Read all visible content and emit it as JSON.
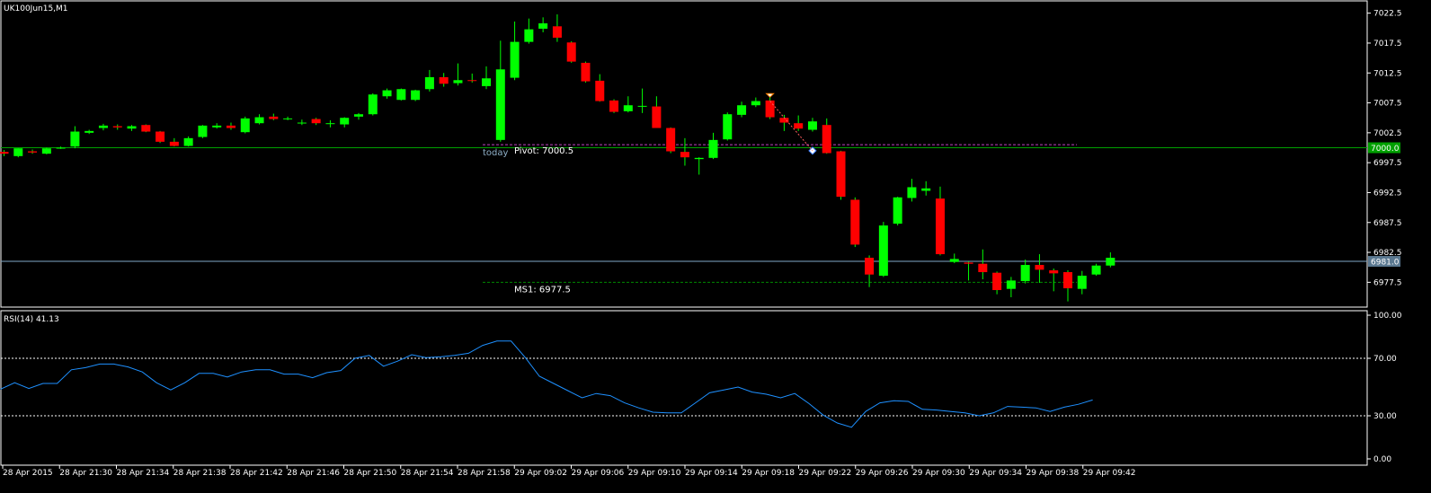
{
  "window": {
    "symbol_label": "UK100Jun15,M1",
    "rsi_label": "RSI(14) 41.13"
  },
  "colors": {
    "background": "#000000",
    "frame": "#ffffff",
    "bull": "#00ff00",
    "bear": "#ff0000",
    "wick": "#00ff00",
    "rsi_line": "#1e90ff",
    "pivot_line": "#00a000",
    "pivot_dash": "#c040c0",
    "bid_line": "#7fa8c8",
    "ms1_dash": "#008800",
    "price_tag_green": "#00a000",
    "price_tag_blue": "#5a7890"
  },
  "chart_data": [
    {
      "type": "candlestick",
      "title": "UK100Jun15,M1",
      "ylim": [
        6973.5,
        7024.4
      ],
      "y_ticks": [
        "7022.5",
        "7017.5",
        "7012.5",
        "7007.5",
        "7002.5",
        "6997.5",
        "6992.5",
        "6987.5",
        "6982.5",
        "6977.5"
      ],
      "y_tick_values": [
        7022.5,
        7017.5,
        7012.5,
        7007.5,
        7002.5,
        6997.5,
        6992.5,
        6987.5,
        6982.5,
        6977.5
      ],
      "price_tags": [
        {
          "text": "7000.0",
          "value": 7000.0,
          "kind": "green"
        },
        {
          "text": "6981.0",
          "value": 6981.0,
          "kind": "blue"
        }
      ],
      "annotations": [
        {
          "text": "today",
          "kind": "today"
        },
        {
          "text": "Pivot: 7000.5",
          "value": 7000.5,
          "kind": "pivot"
        },
        {
          "text": "MS1: 6977.5",
          "value": 6977.5,
          "kind": "ms1"
        }
      ],
      "candles": [
        {
          "o": 6999.3,
          "h": 6999.6,
          "l": 6998.6,
          "c": 6999.0
        },
        {
          "o": 6998.6,
          "h": 6999.9,
          "l": 6998.4,
          "c": 6999.9
        },
        {
          "o": 6999.4,
          "h": 6999.7,
          "l": 6999.0,
          "c": 6999.2
        },
        {
          "o": 6999.0,
          "h": 7000.0,
          "l": 6998.9,
          "c": 6999.9
        },
        {
          "o": 6999.9,
          "h": 7000.2,
          "l": 6999.8,
          "c": 7000.0
        },
        {
          "o": 7000.2,
          "h": 7003.6,
          "l": 6999.9,
          "c": 7002.7
        },
        {
          "o": 7002.5,
          "h": 7003.0,
          "l": 7002.3,
          "c": 7002.8
        },
        {
          "o": 7003.3,
          "h": 7004.0,
          "l": 7002.9,
          "c": 7003.7
        },
        {
          "o": 7003.6,
          "h": 7003.9,
          "l": 7003.0,
          "c": 7003.4
        },
        {
          "o": 7003.2,
          "h": 7003.8,
          "l": 7002.8,
          "c": 7003.6
        },
        {
          "o": 7003.8,
          "h": 7003.9,
          "l": 7002.6,
          "c": 7002.7
        },
        {
          "o": 7002.7,
          "h": 7002.8,
          "l": 7000.8,
          "c": 7001.0
        },
        {
          "o": 7001.0,
          "h": 7001.6,
          "l": 7000.2,
          "c": 7000.3
        },
        {
          "o": 7000.3,
          "h": 7001.9,
          "l": 7000.2,
          "c": 7001.6
        },
        {
          "o": 7001.8,
          "h": 7003.8,
          "l": 7001.6,
          "c": 7003.7
        },
        {
          "o": 7003.4,
          "h": 7004.1,
          "l": 7003.2,
          "c": 7003.7
        },
        {
          "o": 7003.7,
          "h": 7004.2,
          "l": 7003.0,
          "c": 7003.3
        },
        {
          "o": 7002.6,
          "h": 7005.2,
          "l": 7002.4,
          "c": 7004.9
        },
        {
          "o": 7004.1,
          "h": 7005.6,
          "l": 7003.9,
          "c": 7005.1
        },
        {
          "o": 7005.2,
          "h": 7005.7,
          "l": 7004.6,
          "c": 7004.8
        },
        {
          "o": 7004.8,
          "h": 7005.2,
          "l": 7004.6,
          "c": 7004.9
        },
        {
          "o": 7004.2,
          "h": 7004.7,
          "l": 7003.8,
          "c": 7004.2
        },
        {
          "o": 7004.8,
          "h": 7005.0,
          "l": 7003.8,
          "c": 7004.1
        },
        {
          "o": 7004.0,
          "h": 7004.6,
          "l": 7003.4,
          "c": 7004.1
        },
        {
          "o": 7003.9,
          "h": 7005.1,
          "l": 7003.4,
          "c": 7005.0
        },
        {
          "o": 7005.2,
          "h": 7005.8,
          "l": 7004.7,
          "c": 7005.6
        },
        {
          "o": 7005.6,
          "h": 7009.1,
          "l": 7005.4,
          "c": 7008.9
        },
        {
          "o": 7008.6,
          "h": 7009.9,
          "l": 7008.2,
          "c": 7009.6
        },
        {
          "o": 7008.0,
          "h": 7009.9,
          "l": 7007.9,
          "c": 7009.8
        },
        {
          "o": 7008.0,
          "h": 7009.7,
          "l": 7007.8,
          "c": 7009.6
        },
        {
          "o": 7009.8,
          "h": 7013.0,
          "l": 7009.4,
          "c": 7011.8
        },
        {
          "o": 7011.8,
          "h": 7012.5,
          "l": 7010.2,
          "c": 7010.7
        },
        {
          "o": 7010.8,
          "h": 7014.1,
          "l": 7010.4,
          "c": 7011.3
        },
        {
          "o": 7011.3,
          "h": 7012.4,
          "l": 7010.9,
          "c": 7011.2
        },
        {
          "o": 7010.3,
          "h": 7013.6,
          "l": 7009.8,
          "c": 7011.6
        },
        {
          "o": 7001.3,
          "h": 7017.9,
          "l": 7001.0,
          "c": 7013.1
        },
        {
          "o": 7011.7,
          "h": 7021.1,
          "l": 7011.3,
          "c": 7017.7
        },
        {
          "o": 7017.7,
          "h": 7021.6,
          "l": 7017.4,
          "c": 7019.8
        },
        {
          "o": 7019.9,
          "h": 7021.8,
          "l": 7019.3,
          "c": 7020.8
        },
        {
          "o": 7020.3,
          "h": 7022.3,
          "l": 7017.7,
          "c": 7018.4
        },
        {
          "o": 7017.6,
          "h": 7017.8,
          "l": 7014.2,
          "c": 7014.4
        },
        {
          "o": 7014.2,
          "h": 7014.4,
          "l": 7010.9,
          "c": 7011.1
        },
        {
          "o": 7011.2,
          "h": 7012.3,
          "l": 7007.7,
          "c": 7007.8
        },
        {
          "o": 7007.9,
          "h": 7008.1,
          "l": 7005.8,
          "c": 7006.0
        },
        {
          "o": 7006.1,
          "h": 7008.6,
          "l": 7005.9,
          "c": 7007.1
        },
        {
          "o": 7006.9,
          "h": 7009.9,
          "l": 7005.8,
          "c": 7007.0
        },
        {
          "o": 7006.9,
          "h": 7008.6,
          "l": 7003.6,
          "c": 7003.3
        },
        {
          "o": 7003.3,
          "h": 7003.4,
          "l": 6999.1,
          "c": 6999.4
        },
        {
          "o": 6999.3,
          "h": 7001.6,
          "l": 6997.0,
          "c": 6998.4
        },
        {
          "o": 6998.1,
          "h": 6998.4,
          "l": 6995.5,
          "c": 6998.3
        },
        {
          "o": 6998.3,
          "h": 7002.5,
          "l": 6998.1,
          "c": 7001.3
        },
        {
          "o": 7001.4,
          "h": 7005.9,
          "l": 7001.2,
          "c": 7005.6
        },
        {
          "o": 7005.5,
          "h": 7007.7,
          "l": 7005.1,
          "c": 7007.1
        },
        {
          "o": 7007.1,
          "h": 7008.4,
          "l": 7006.8,
          "c": 7007.8
        },
        {
          "o": 7007.9,
          "h": 7009.0,
          "l": 7004.8,
          "c": 7005.1
        },
        {
          "o": 7005.0,
          "h": 7005.5,
          "l": 7002.8,
          "c": 7004.2
        },
        {
          "o": 7004.1,
          "h": 7005.4,
          "l": 7002.8,
          "c": 7003.2
        },
        {
          "o": 7003.0,
          "h": 7005.0,
          "l": 7002.7,
          "c": 7004.4
        },
        {
          "o": 7003.8,
          "h": 7004.9,
          "l": 6999.0,
          "c": 6999.1
        },
        {
          "o": 6999.4,
          "h": 6999.5,
          "l": 6991.3,
          "c": 6991.8
        },
        {
          "o": 6991.3,
          "h": 6991.7,
          "l": 6983.4,
          "c": 6983.8
        },
        {
          "o": 6981.6,
          "h": 6982.0,
          "l": 6976.7,
          "c": 6978.8
        },
        {
          "o": 6978.6,
          "h": 6987.6,
          "l": 6978.4,
          "c": 6987.0
        },
        {
          "o": 6987.3,
          "h": 6991.8,
          "l": 6987.0,
          "c": 6991.7
        },
        {
          "o": 6991.6,
          "h": 6994.8,
          "l": 6991.0,
          "c": 6993.4
        },
        {
          "o": 6992.8,
          "h": 6994.4,
          "l": 6992.0,
          "c": 6993.2
        },
        {
          "o": 6991.5,
          "h": 6993.5,
          "l": 6982.0,
          "c": 6982.2
        },
        {
          "o": 6980.9,
          "h": 6982.3,
          "l": 6980.7,
          "c": 6981.4
        },
        {
          "o": 6980.8,
          "h": 6981.0,
          "l": 6977.8,
          "c": 6980.6
        },
        {
          "o": 6980.6,
          "h": 6983.0,
          "l": 6978.0,
          "c": 6979.2
        },
        {
          "o": 6979.1,
          "h": 6979.3,
          "l": 6975.5,
          "c": 6976.2
        },
        {
          "o": 6976.4,
          "h": 6978.4,
          "l": 6975.0,
          "c": 6977.8
        },
        {
          "o": 6977.7,
          "h": 6981.3,
          "l": 6977.3,
          "c": 6980.4
        },
        {
          "o": 6980.4,
          "h": 6982.2,
          "l": 6977.4,
          "c": 6979.6
        },
        {
          "o": 6979.5,
          "h": 6979.8,
          "l": 6976.0,
          "c": 6979.0
        },
        {
          "o": 6979.2,
          "h": 6979.5,
          "l": 6974.3,
          "c": 6976.5
        },
        {
          "o": 6976.4,
          "h": 6979.4,
          "l": 6975.5,
          "c": 6978.6
        },
        {
          "o": 6978.8,
          "h": 6980.6,
          "l": 6978.6,
          "c": 6980.3
        },
        {
          "o": 6980.3,
          "h": 6982.5,
          "l": 6980.0,
          "c": 6981.6
        }
      ]
    },
    {
      "type": "line",
      "title": "RSI(14) 41.13",
      "ylim": [
        0,
        100
      ],
      "y_ticks": [
        "100.00",
        "70.00",
        "30.00",
        "0.00"
      ],
      "y_tick_values": [
        100,
        70,
        30,
        0
      ],
      "levels": [
        70,
        30
      ],
      "series": [
        {
          "values": [
            48.5,
            53.0,
            49.0,
            52.5,
            52.5,
            62.0,
            63.5,
            66.0,
            66.0,
            64.0,
            60.5,
            53.0,
            48.0,
            53.0,
            59.5,
            59.5,
            57.0,
            60.5,
            62.0,
            62.0,
            59.0,
            59.0,
            56.5,
            60.0,
            61.5,
            70.0,
            72.0,
            64.5,
            68.0,
            72.5,
            70.5,
            71.0,
            72.0,
            73.5,
            79.0,
            82.0,
            82.0,
            70.5,
            57.5,
            52.5,
            47.5,
            42.5,
            45.5,
            44.0,
            39.0,
            35.5,
            32.5,
            32.0,
            32.0,
            39.0,
            46.0,
            48.0,
            50.0,
            46.5,
            45.0,
            42.5,
            45.5,
            38.5,
            30.5,
            25.0,
            22.0,
            33.0,
            39.0,
            40.5,
            40.0,
            34.5,
            34.0,
            33.0,
            32.0,
            30.0,
            32.0,
            36.5,
            36.0,
            35.5,
            33.0,
            36.0,
            38.0,
            41.0
          ]
        }
      ]
    }
  ],
  "time_axis": {
    "labels": [
      "28 Apr 2015",
      "28 Apr 21:30",
      "28 Apr 21:34",
      "28 Apr 21:38",
      "28 Apr 21:42",
      "28 Apr 21:46",
      "28 Apr 21:50",
      "28 Apr 21:54",
      "28 Apr 21:58",
      "29 Apr 09:02",
      "29 Apr 09:06",
      "29 Apr 09:10",
      "29 Apr 09:14",
      "29 Apr 09:18",
      "29 Apr 09:22",
      "29 Apr 09:26",
      "29 Apr 09:30",
      "29 Apr 09:34",
      "29 Apr 09:38",
      "29 Apr 09:42"
    ]
  }
}
